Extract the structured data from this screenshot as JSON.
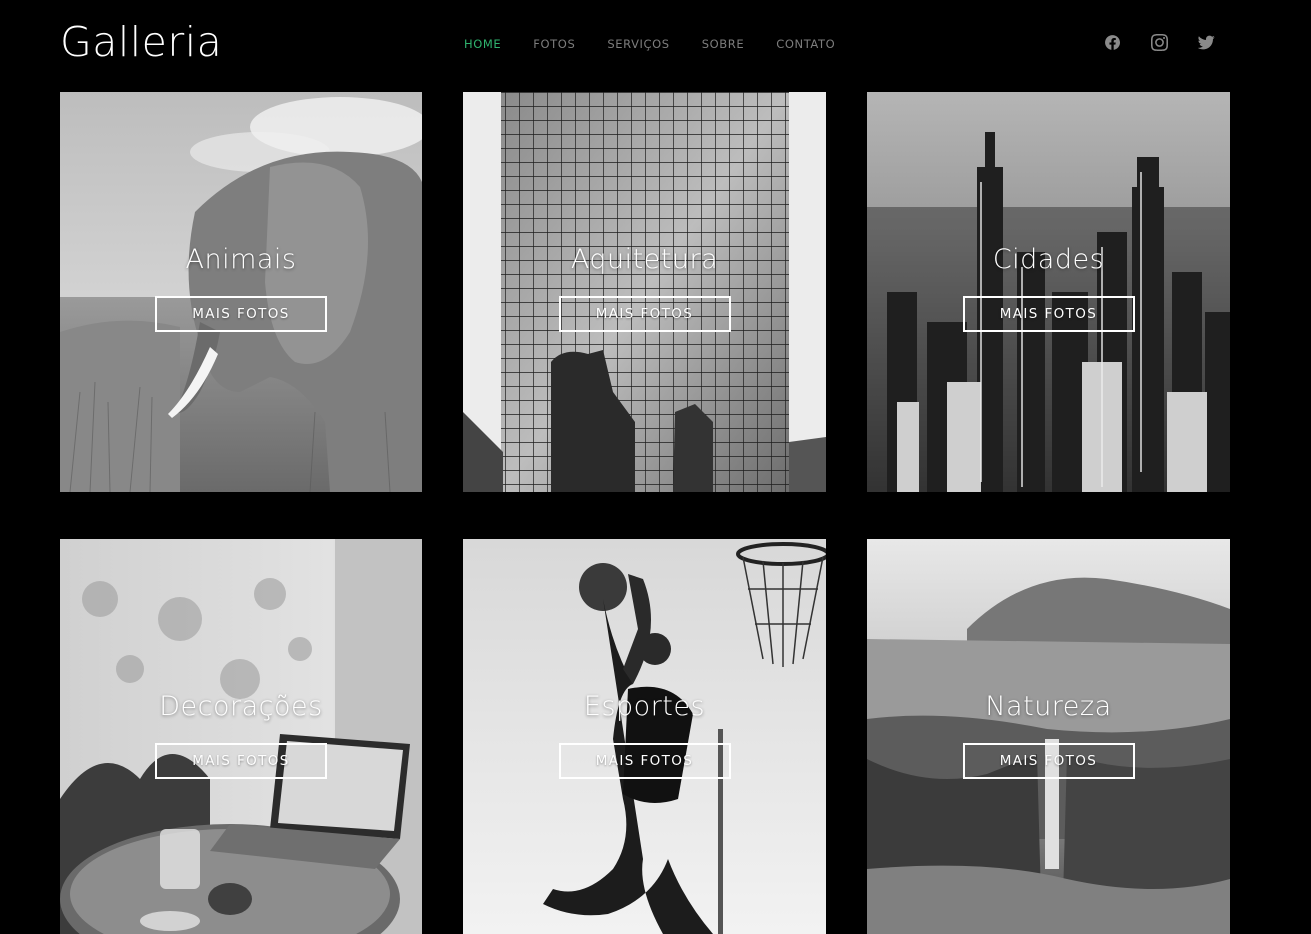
{
  "brand": "Galleria",
  "nav": [
    {
      "label": "HOME",
      "active": true
    },
    {
      "label": "FOTOS",
      "active": false
    },
    {
      "label": "SERVIÇOS",
      "active": false
    },
    {
      "label": "SOBRE",
      "active": false
    },
    {
      "label": "CONTATO",
      "active": false
    }
  ],
  "social": [
    "facebook-icon",
    "instagram-icon",
    "twitter-icon"
  ],
  "colors": {
    "accent": "#2fb36e",
    "nav": "#7d7d7d",
    "background": "#000000"
  },
  "gallery": [
    {
      "title": "Animais",
      "button": "MAIS FOTOS",
      "subject": "elephant in grassland"
    },
    {
      "title": "Aquitetura",
      "button": "MAIS FOTOS",
      "subject": "glass skyscraper facade"
    },
    {
      "title": "Cidades",
      "button": "MAIS FOTOS",
      "subject": "city skyline aerial"
    },
    {
      "title": "Decorações",
      "button": "MAIS FOTOS",
      "subject": "cafe table with laptop"
    },
    {
      "title": "Esportes",
      "button": "MAIS FOTOS",
      "subject": "basketball player dunking"
    },
    {
      "title": "Natureza",
      "button": "MAIS FOTOS",
      "subject": "mountain waterfall cliffs"
    }
  ]
}
